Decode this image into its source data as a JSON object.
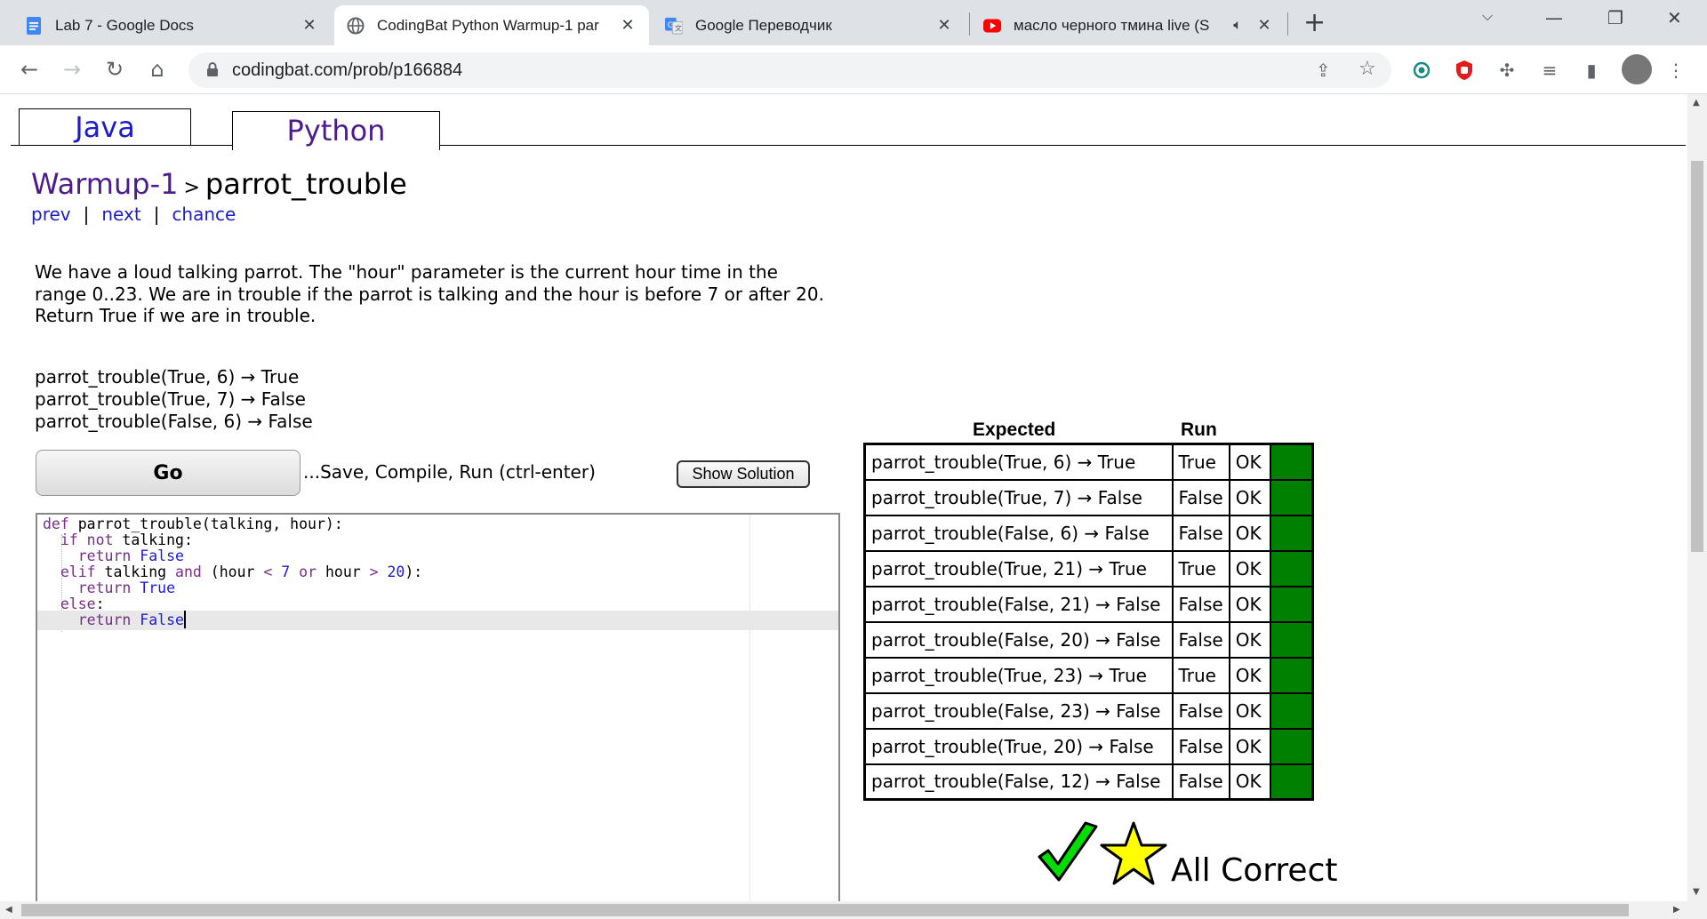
{
  "browser": {
    "tabs": [
      {
        "title": "Lab 7 - Google Docs",
        "icon": "docs-icon",
        "active": false
      },
      {
        "title": "CodingBat Python Warmup-1 par",
        "icon": "globe-icon",
        "active": true
      },
      {
        "title": "Google Переводчик",
        "icon": "translate-icon",
        "active": false
      },
      {
        "title": "масло черного тмина live (S",
        "icon": "youtube-icon",
        "active": false,
        "audio": true
      }
    ],
    "url": "codingbat.com/prob/p166884",
    "colors": {
      "tabbar": "#dee1e6",
      "omnibox": "#f1f3f4"
    }
  },
  "lang_tabs": {
    "java": "Java",
    "python": "Python"
  },
  "breadcrumb": {
    "section": "Warmup-1",
    "separator": ">",
    "problem": "parrot_trouble"
  },
  "nav_links": {
    "prev": "prev",
    "next": "next",
    "chance": "chance",
    "sep": "|"
  },
  "description": "We have a loud talking parrot. The \"hour\" parameter is the current hour time in the range 0..23. We are in trouble if the parrot is talking and the hour is before 7 or after 20. Return True if we are in trouble.",
  "examples": [
    "parrot_trouble(True, 6) → True",
    "parrot_trouble(True, 7) → False",
    "parrot_trouble(False, 6) → False"
  ],
  "buttons": {
    "go": "Go",
    "go_hint": "...Save, Compile, Run (ctrl-enter)",
    "show_solution": "Show Solution"
  },
  "code": {
    "l1_kw": "def",
    "l1_rest": " parrot_trouble(talking, hour):",
    "l2_kw": "if not",
    "l2_rest": " talking:",
    "l3_kw": "return",
    "l3_lit": "False",
    "l4_kw": "elif",
    "l4_a": " talking ",
    "l4_and": "and",
    "l4_b": " (hour ",
    "l4_lt": "<",
    "l4_7": "7",
    "l4_or": "or",
    "l4_c": " hour ",
    "l4_gt": ">",
    "l4_20": "20",
    "l4_d": "):",
    "l5_kw": "return",
    "l5_lit": "True",
    "l6_kw": "else",
    "l6_rest": ":",
    "l7_kw": "return",
    "l7_lit": "False"
  },
  "results": {
    "header_expected": "Expected",
    "header_run": "Run",
    "pass_color": "#008000",
    "rows": [
      {
        "expected": "parrot_trouble(True, 6) → True",
        "run": "True",
        "status": "OK"
      },
      {
        "expected": "parrot_trouble(True, 7) → False",
        "run": "False",
        "status": "OK"
      },
      {
        "expected": "parrot_trouble(False, 6) → False",
        "run": "False",
        "status": "OK"
      },
      {
        "expected": "parrot_trouble(True, 21) → True",
        "run": "True",
        "status": "OK"
      },
      {
        "expected": "parrot_trouble(False, 21) → False",
        "run": "False",
        "status": "OK"
      },
      {
        "expected": "parrot_trouble(False, 20) → False",
        "run": "False",
        "status": "OK"
      },
      {
        "expected": "parrot_trouble(True, 23) → True",
        "run": "True",
        "status": "OK"
      },
      {
        "expected": "parrot_trouble(False, 23) → False",
        "run": "False",
        "status": "OK"
      },
      {
        "expected": "parrot_trouble(True, 20) → False",
        "run": "False",
        "status": "OK"
      },
      {
        "expected": "parrot_trouble(False, 12) → False",
        "run": "False",
        "status": "OK"
      }
    ]
  },
  "all_correct": "All Correct"
}
